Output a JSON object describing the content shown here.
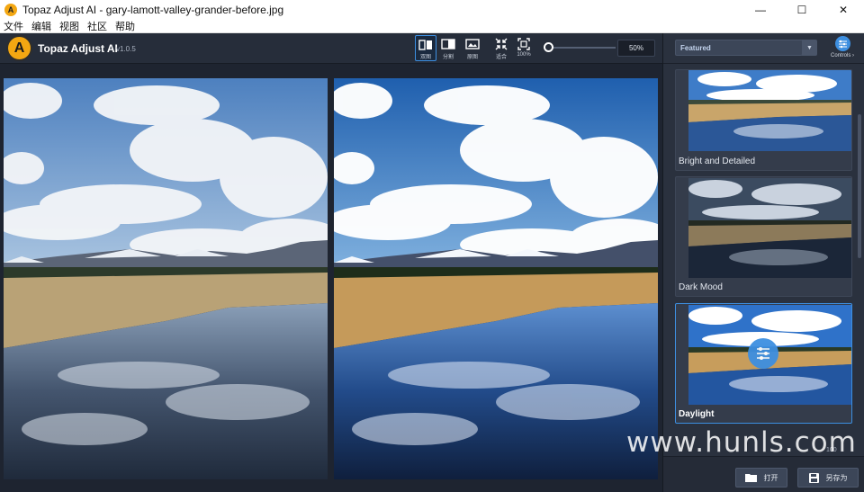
{
  "window": {
    "title": "Topaz Adjust AI - gary-lamott-valley-grander-before.jpg",
    "minimize_glyph": "—",
    "maximize_glyph": "☐",
    "close_glyph": "✕"
  },
  "menu": [
    "文件",
    "编辑",
    "视图",
    "社区",
    "帮助"
  ],
  "app": {
    "name": "Topaz Adjust AI",
    "version": "v1.0.5",
    "logo_letter": "A"
  },
  "toolbar": {
    "tools": [
      {
        "label": "双图",
        "icon": "split-view-icon",
        "active": true
      },
      {
        "label": "分割",
        "icon": "compare-split-icon",
        "active": false
      },
      {
        "label": "原图",
        "icon": "original-image-icon",
        "active": false
      },
      {
        "label": "适合",
        "icon": "fit-screen-icon",
        "active": false
      },
      {
        "label": "100%",
        "icon": "actual-size-icon",
        "active": false
      }
    ],
    "zoom_value": "50%"
  },
  "sidebar": {
    "category": "Featured",
    "controls_label": "Controls ›",
    "presets": [
      {
        "name": "Bright and Detailed",
        "selected": false
      },
      {
        "name": "Dark Mood",
        "selected": false
      },
      {
        "name": "Daylight",
        "selected": true
      }
    ],
    "open_label": "打开",
    "save_as_label": "另存为",
    "footer_value": "100"
  },
  "watermark": "www.hunls.com",
  "colors": {
    "accent": "#3d8fe0",
    "brand": "#f3a712",
    "panel": "#2a313e",
    "background": "#1e2430"
  }
}
